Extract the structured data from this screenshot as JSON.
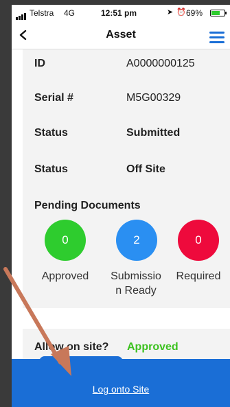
{
  "status_bar": {
    "carrier": "Telstra",
    "network": "4G",
    "time": "12:51 pm",
    "battery": "69%",
    "icons": [
      "signal-icon",
      "location-icon",
      "alarm-icon",
      "battery-icon"
    ]
  },
  "nav": {
    "title": "Asset",
    "back_icon": "chevron-left-icon",
    "menu_icon": "hamburger-menu-icon",
    "accent_color": "#1a6ed6"
  },
  "details": [
    {
      "label": "ID",
      "value": "A0000000125"
    },
    {
      "label": "Serial #",
      "value": "M5G00329"
    },
    {
      "label": "Status",
      "value": "Submitted"
    },
    {
      "label": "Status",
      "value": "Off Site"
    }
  ],
  "pending": {
    "title": "Pending Documents",
    "items": [
      {
        "count": "0",
        "label_line1": "Approved",
        "label_line2": "",
        "color": "#2ecc2e"
      },
      {
        "count": "2",
        "label_line1": "Submissio",
        "label_line2": "n Ready",
        "color": "#2a8ff2"
      },
      {
        "count": "0",
        "label_line1": "Required",
        "label_line2": "",
        "color": "#ee0a3c"
      }
    ]
  },
  "allow": {
    "label": "Allow on site?",
    "value": "Approved",
    "value_color": "#3cc21f"
  },
  "action": {
    "login_label": "Log onto Site"
  }
}
